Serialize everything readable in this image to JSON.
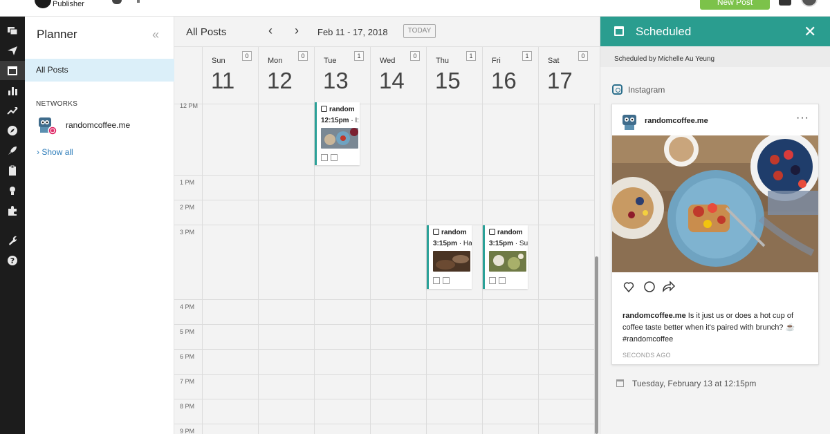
{
  "topbar": {
    "product": "Publisher",
    "new_post_label": "New Post"
  },
  "leftnav": {
    "items": [
      "streams-icon",
      "publisher-icon",
      "planner-icon",
      "analytics-icon",
      "growth-icon",
      "explore-icon",
      "launch-icon",
      "assignments-icon",
      "insights-icon",
      "apps-icon",
      "tools-icon",
      "help-icon"
    ],
    "active": "planner-icon"
  },
  "planner": {
    "title": "Planner",
    "all_posts": "All Posts",
    "networks_heading": "NETWORKS",
    "network_name": "randomcoffee.me",
    "show_all": "Show all"
  },
  "calendar": {
    "title": "All Posts",
    "range": "Feb 11 - 17, 2018",
    "today_label": "TODAY",
    "days": [
      {
        "name": "Sun",
        "num": "11",
        "count": "0"
      },
      {
        "name": "Mon",
        "num": "12",
        "count": "0"
      },
      {
        "name": "Tue",
        "num": "13",
        "count": "1"
      },
      {
        "name": "Wed",
        "num": "14",
        "count": "0"
      },
      {
        "name": "Thu",
        "num": "15",
        "count": "1"
      },
      {
        "name": "Fri",
        "num": "16",
        "count": "1"
      },
      {
        "name": "Sat",
        "num": "17",
        "count": "0"
      }
    ],
    "times": [
      "12 PM",
      "1 PM",
      "2 PM",
      "3 PM",
      "4 PM",
      "5 PM",
      "6 PM",
      "7 PM",
      "8 PM",
      "9 PM"
    ],
    "posts": [
      {
        "account": "random",
        "time": "12:15pm",
        "text": "· I:",
        "thumb_color": "#5b6a76"
      },
      {
        "account": "random",
        "time": "3:15pm",
        "text": "· Ha",
        "thumb_color": "#4a3424"
      },
      {
        "account": "random",
        "time": "3:15pm",
        "text": "· Su",
        "thumb_color": "#6f7a45"
      }
    ]
  },
  "scheduled": {
    "title": "Scheduled",
    "byline": "Scheduled by Michelle Au Yeung",
    "network": "Instagram",
    "username": "randomcoffee.me",
    "caption_user": "randomcoffee.me",
    "caption_text": " Is it just us or does a hot cup of coffee taste better when it's paired with brunch? ☕ #randomcoffee",
    "ago": "SECONDS AGO",
    "when": "Tuesday, February 13 at 12:15pm"
  }
}
